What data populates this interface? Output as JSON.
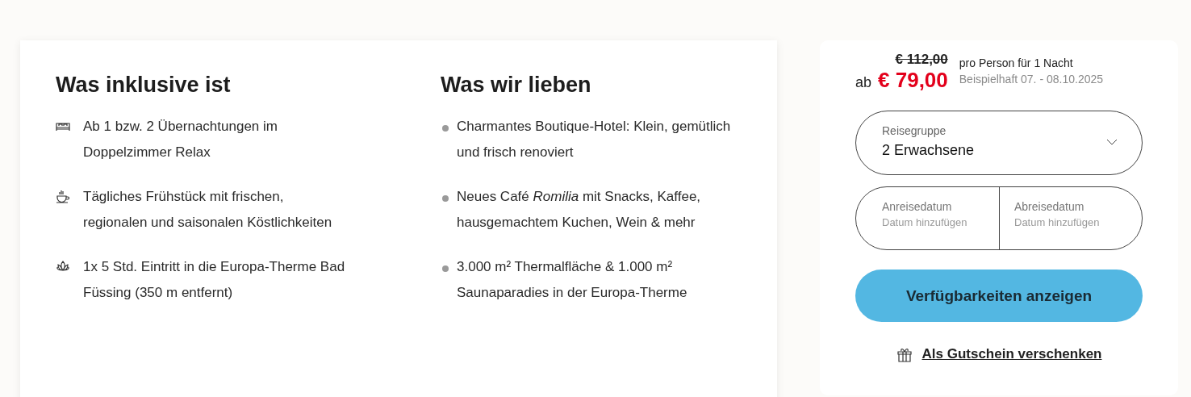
{
  "included": {
    "title": "Was inklusive ist",
    "items": [
      {
        "kind": "bed",
        "text": "Ab 1 bzw. 2 Übernachtungen im Doppelzimmer Relax"
      },
      {
        "kind": "cup",
        "text": "Tägliches Frühstück mit frischen, regionalen und saisonalen Köstlichkeiten"
      },
      {
        "kind": "lotus",
        "text": "1x 5 Std. Eintritt in die Europa-Therme Bad Füssing (350 m entfernt)"
      }
    ]
  },
  "loved": {
    "title": "Was wir lieben",
    "items": [
      "Charmantes Boutique-Hotel: Klein, gemütlich und frisch renoviert",
      "Neues Café *Romilia* mit Snacks, Kaffee, hausgemachtem Kuchen, Wein & mehr",
      "3.000 m² Thermalfläche & 1.000 m² Saunaparadies in der Europa-Therme"
    ]
  },
  "booking": {
    "old_price": "€ 112,00",
    "prefix": "ab",
    "price": "€ 79,00",
    "per": "pro Person für 1 Nacht",
    "example": "Beispielhaft 07. - 08.10.2025",
    "group": {
      "label": "Reisegruppe",
      "value": "2 Erwachsene"
    },
    "dates": [
      {
        "label": "Anreisedatum",
        "placeholder": "Datum hinzufügen"
      },
      {
        "label": "Abreisedatum",
        "placeholder": "Datum hinzufügen"
      }
    ],
    "button": "Verfügbarkeiten anzeigen",
    "gift_link": "Als Gutschein verschenken"
  }
}
